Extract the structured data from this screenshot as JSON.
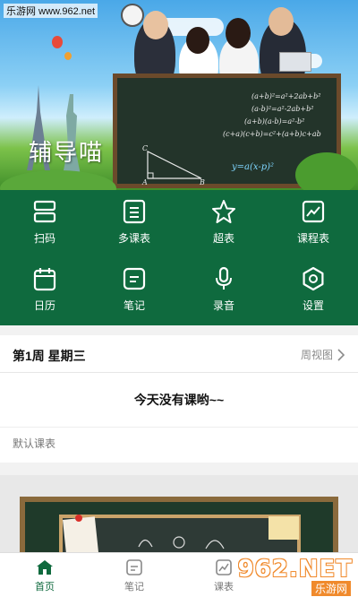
{
  "banner": {
    "watermark": "乐游网 www.962.net",
    "app_name": "辅导喵",
    "formulas": [
      "(a+b)²=a²+2ab+b²",
      "(a-b)²=a²-2ab+b²",
      "(a+b)(a-b)=a²-b²",
      "(c+a)(c+b)=c²+(a+b)c+ab",
      "y=a(x-p)²"
    ],
    "triangle_labels": [
      "C",
      "A",
      "B"
    ]
  },
  "menu": {
    "items": [
      {
        "label": "扫码",
        "icon": "scan-icon"
      },
      {
        "label": "多课表",
        "icon": "multi-schedule-icon"
      },
      {
        "label": "超表",
        "icon": "star-icon"
      },
      {
        "label": "课程表",
        "icon": "chart-icon"
      },
      {
        "label": "日历",
        "icon": "calendar-icon"
      },
      {
        "label": "笔记",
        "icon": "note-icon"
      },
      {
        "label": "录音",
        "icon": "microphone-icon"
      },
      {
        "label": "设置",
        "icon": "settings-icon"
      }
    ]
  },
  "week": {
    "title": "第1周  星期三",
    "view_link": "周视图"
  },
  "today": {
    "empty_message": "今天没有课哟~~"
  },
  "default_schedule": {
    "label": "默认课表"
  },
  "tabbar": {
    "tabs": [
      {
        "label": "首页",
        "icon": "home-icon",
        "active": true
      },
      {
        "label": "笔记",
        "icon": "note-icon",
        "active": false
      },
      {
        "label": "课表",
        "icon": "schedule-icon",
        "active": false
      }
    ]
  },
  "watermark_bottom": {
    "big": "962.NET",
    "small": "乐游网"
  },
  "colors": {
    "primary_green": "#0f6a3e",
    "chalkboard": "#23342a",
    "watermark_orange": "#f08a2c"
  }
}
